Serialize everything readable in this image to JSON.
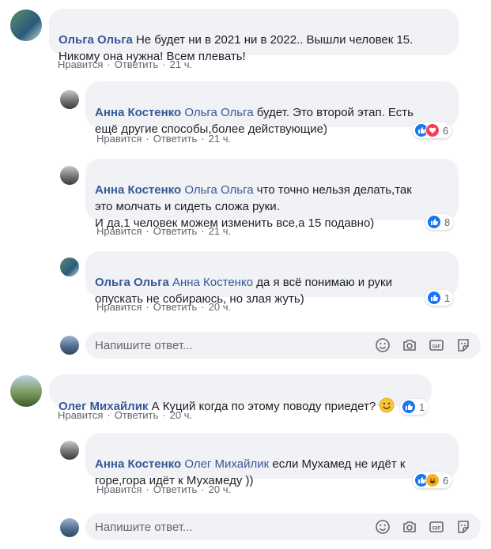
{
  "comments": [
    {
      "author": "Ольга Ольга",
      "text": "Не будет ни в 2021 ни в 2022.. Вышли человек 15.\nНикому она нужна! Всем плевать!",
      "like_label": "Нравится",
      "reply_label": "Ответить",
      "time": "21 ч."
    },
    {
      "author": "Анна Костенко",
      "mention": "Ольга Ольга",
      "text": "будет. Это второй этап. Есть\nещё другие способы,более действующие)",
      "like_label": "Нравится",
      "reply_label": "Ответить",
      "time": "21 ч.",
      "reaction_count": "6"
    },
    {
      "author": "Анна Костенко",
      "mention": "Ольга Ольга",
      "text": "что точно нельзя делать,так\nэто молчать и сидеть сложа руки.\nИ да,1 человек можем изменить все,а 15 подавно)",
      "like_label": "Нравится",
      "reply_label": "Ответить",
      "time": "21 ч.",
      "reaction_count": "8"
    },
    {
      "author": "Ольга Ольга",
      "mention": "Анна Костенко",
      "text": "да я всё понимаю и руки\nопускать не собираюсь, но злая жуть)",
      "like_label": "Нравится",
      "reply_label": "Ответить",
      "time": "20 ч.",
      "reaction_count": "1"
    },
    {
      "author": "Олег Михайлик",
      "text": "А Куций когда по этому поводу приедет?",
      "like_label": "Нравится",
      "reply_label": "Ответить",
      "time": "20 ч.",
      "reaction_count": "1"
    },
    {
      "author": "Анна Костенко",
      "mention": "Олег Михайлик",
      "text": "если Мухамед не идёт к\nгоре,гора идёт к Мухамеду ))",
      "like_label": "Нравится",
      "reply_label": "Ответить",
      "time": "20 ч.",
      "reaction_count": "6"
    }
  ],
  "reply_box": {
    "placeholder": "Напишите ответ..."
  },
  "colors": {
    "author": "#385898",
    "bubble": "#f0f2f5",
    "meta": "#606770",
    "like": "#1877f2",
    "love": "#f33e58",
    "haha": "#f7b125"
  },
  "icons": [
    "emoji-icon",
    "camera-icon",
    "gif-icon",
    "sticker-icon",
    "like-reaction-icon",
    "love-reaction-icon",
    "haha-reaction-icon",
    "smiley-emoji-icon"
  ]
}
